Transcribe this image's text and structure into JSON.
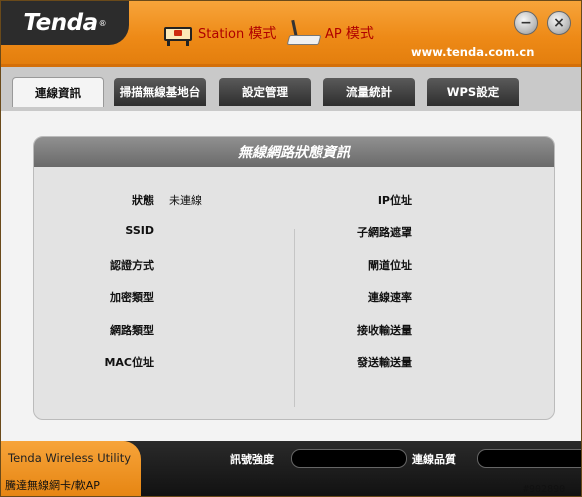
{
  "app": {
    "logo": "Tenda",
    "logo_mark": "®",
    "url": "www.tenda.com.cn"
  },
  "modes": {
    "station": {
      "label": "Station",
      "suffix": "模式"
    },
    "ap": {
      "label": "AP",
      "suffix": "模式"
    }
  },
  "tabs": [
    {
      "label": "連線資訊"
    },
    {
      "label": "掃描無線基地台"
    },
    {
      "label": "設定管理"
    },
    {
      "label": "流量統計"
    },
    {
      "label": "WPS設定"
    }
  ],
  "panel": {
    "title": "無線網路狀態資訊",
    "left": [
      {
        "label": "狀態",
        "value": "未連線"
      },
      {
        "label": "SSID",
        "value": ""
      },
      {
        "label": "認證方式",
        "value": ""
      },
      {
        "label": "加密類型",
        "value": ""
      },
      {
        "label": "網路類型",
        "value": ""
      },
      {
        "label": "MAC位址",
        "value": ""
      }
    ],
    "right": [
      {
        "label": "IP位址",
        "value": ""
      },
      {
        "label": "子網路遮罩",
        "value": ""
      },
      {
        "label": "閘道位址",
        "value": ""
      },
      {
        "label": "連線速率",
        "value": ""
      },
      {
        "label": "接收輸送量",
        "value": ""
      },
      {
        "label": "發送輸送量",
        "value": ""
      }
    ]
  },
  "footer": {
    "product": "Tenda Wireless Utility",
    "subtitle": "騰達無線網卡/軟AP",
    "signal_label": "訊號強度",
    "quality_label": "連線品質",
    "stamp": "#902890"
  },
  "colors": {
    "header_orange": "#ee8a17",
    "mode_text": "#b00000",
    "tab_dark": "#3a3a3a"
  }
}
